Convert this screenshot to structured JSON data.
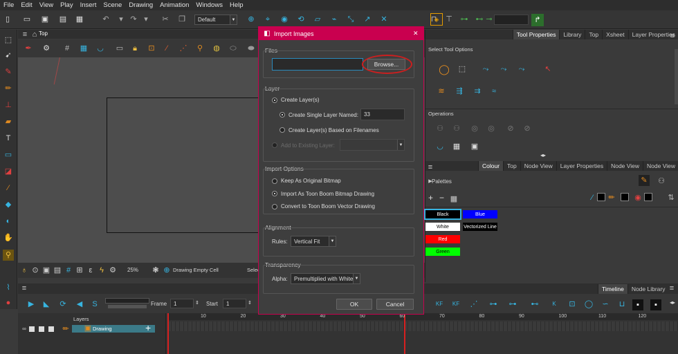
{
  "menu": [
    "File",
    "Edit",
    "View",
    "Play",
    "Insert",
    "Scene",
    "Drawing",
    "Animation",
    "Windows",
    "Help"
  ],
  "toolbar": {
    "workspace": "Default"
  },
  "view": {
    "tab": "Top",
    "zoom": "25%",
    "status": "Drawing Empty Cell",
    "select_label": "Selec"
  },
  "toolprops": {
    "tabs": [
      "Tool Properties",
      "Library",
      "Top",
      "Xsheet",
      "Layer Properties"
    ],
    "section_select": "Select Tool Options",
    "section_ops": "Operations"
  },
  "colour": {
    "tabs": [
      "Colour",
      "Top",
      "Node View",
      "Layer Properties",
      "Node View",
      "Node View"
    ],
    "palettes_label": "Palettes",
    "swatches": [
      {
        "name": "Black",
        "color": "#000000",
        "text": "#ffffff"
      },
      {
        "name": "Blue",
        "color": "#0000ff",
        "text": "#ffffff"
      },
      {
        "name": "White",
        "color": "#ffffff",
        "text": "#000000"
      },
      {
        "name": "Vectorized Line",
        "color": "#000000",
        "text": "#ffffff"
      },
      {
        "name": "Red",
        "color": "#ff0000",
        "text": "#ffffff"
      },
      {
        "name": "Green",
        "color": "#00ff00",
        "text": "#000000"
      }
    ]
  },
  "timeline": {
    "tabs": [
      "Timeline",
      "Node Library"
    ],
    "frame_label": "Frame",
    "frame_value": "1",
    "start_label": "Start",
    "start_value": "1",
    "layers_header": "Layers",
    "layer_name": "Drawing",
    "ticks": [
      "10",
      "20",
      "30",
      "40",
      "50",
      "60",
      "70",
      "80",
      "90",
      "100",
      "110",
      "120"
    ]
  },
  "dialog": {
    "title": "Import Images",
    "files_label": "Files",
    "file_path": "",
    "browse": "Browse...",
    "layer_label": "Layer",
    "create_layers": "Create Layer(s)",
    "create_single": "Create Single Layer Named:",
    "layer_name_value": "33",
    "create_based": "Create Layer(s) Based on Filenames",
    "add_existing": "Add to Existing Layer:",
    "import_options_label": "Import Options",
    "keep_bitmap": "Keep As Original Bitmap",
    "import_toon": "Import As Toon Boom Bitmap Drawing",
    "convert_vector": "Convert to Toon Boom Vector Drawing",
    "alignment_label": "Alignment",
    "rules_label": "Rules:",
    "rules_value": "Vertical Fit",
    "transparency_label": "Transparency",
    "alpha_label": "Alpha:",
    "alpha_value": "Premultiplied with White",
    "ok": "OK",
    "cancel": "Cancel",
    "close": "✕"
  },
  "colors": {
    "accent": "#c9004f",
    "highlight_ring": "#cc1f1f",
    "icon_cyan": "#37b4e0"
  }
}
